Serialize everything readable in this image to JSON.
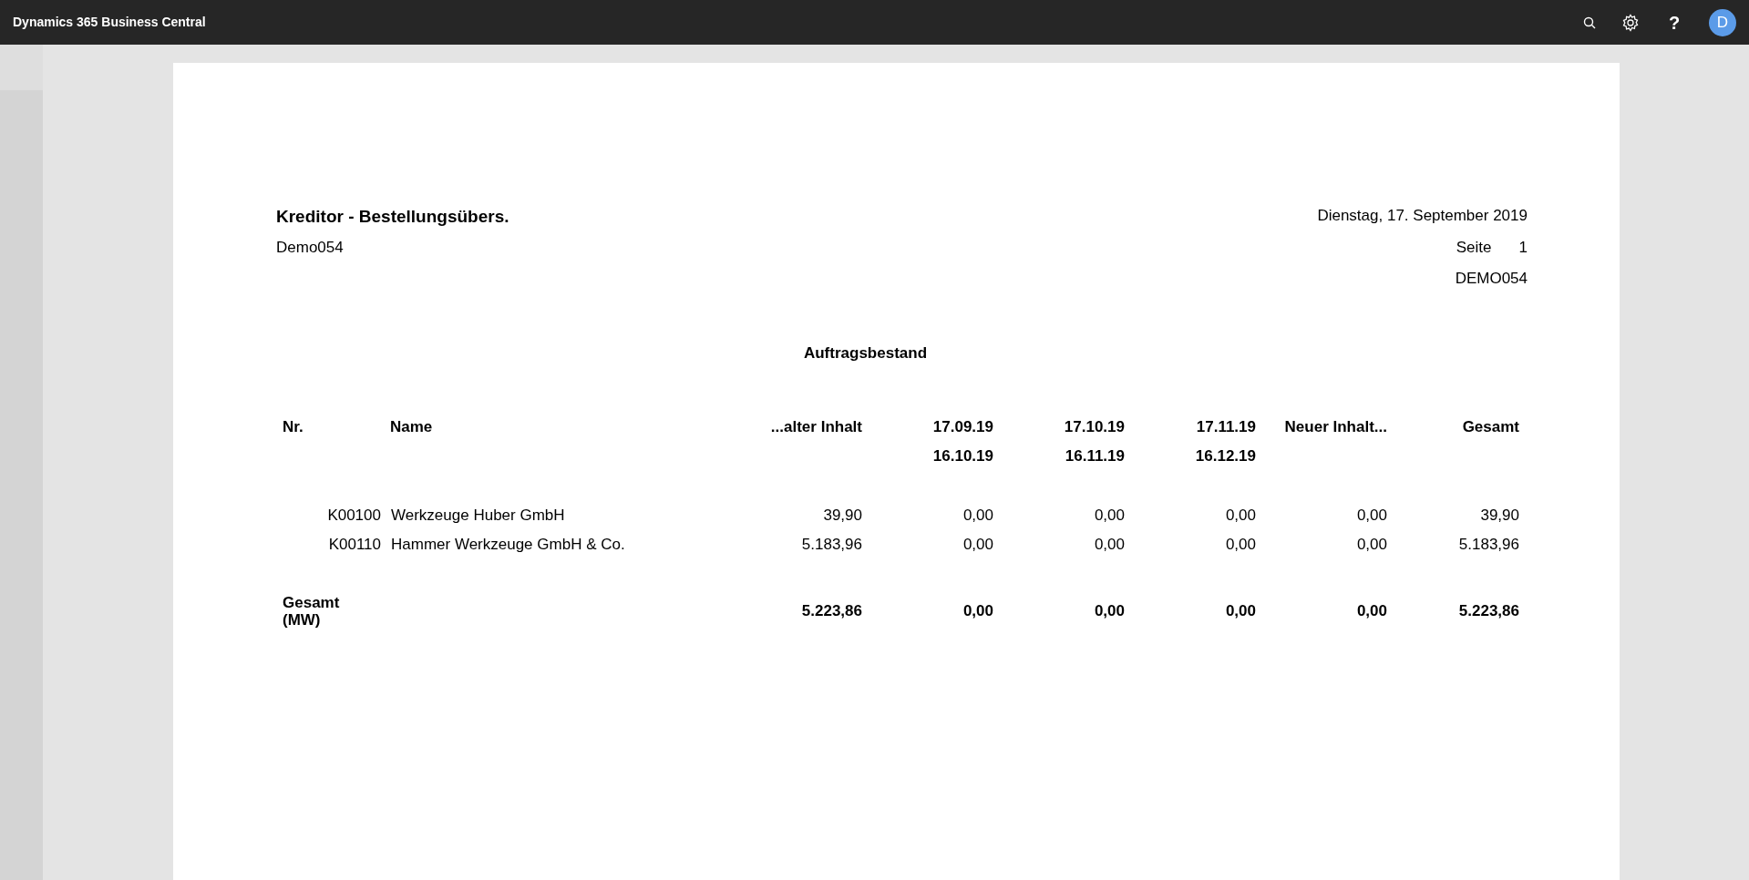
{
  "top_bar": {
    "app_title": "Dynamics 365 Business Central",
    "help_label": "?",
    "avatar_initial": "D"
  },
  "report": {
    "title": "Kreditor - Bestellungsübers.",
    "company": "Demo054",
    "date": "Dienstag, 17. September 2019",
    "page_label": "Seite",
    "page_number": "1",
    "user": "DEMO054",
    "section_title": "Auftragsbestand",
    "columns": [
      {
        "lines": [
          "Nr."
        ]
      },
      {
        "lines": [
          "Name"
        ]
      },
      {
        "lines": [
          "...alter Inhalt"
        ]
      },
      {
        "lines": [
          "17.09.19",
          "16.10.19"
        ]
      },
      {
        "lines": [
          "17.10.19",
          "16.11.19"
        ]
      },
      {
        "lines": [
          "17.11.19",
          "16.12.19"
        ]
      },
      {
        "lines": [
          "Neuer Inhalt..."
        ]
      },
      {
        "lines": [
          "Gesamt"
        ]
      }
    ],
    "rows": [
      {
        "nr": "K00100",
        "name": "Werkzeuge Huber GmbH",
        "values": [
          "39,90",
          "0,00",
          "0,00",
          "0,00",
          "0,00",
          "39,90"
        ]
      },
      {
        "nr": "K00110",
        "name": "Hammer Werkzeuge GmbH & Co.",
        "values": [
          "5.183,96",
          "0,00",
          "0,00",
          "0,00",
          "0,00",
          "5.183,96"
        ]
      }
    ],
    "total": {
      "label_lines": [
        "Gesamt",
        "(MW)"
      ],
      "values": [
        "5.223,86",
        "0,00",
        "0,00",
        "0,00",
        "0,00",
        "5.223,86"
      ]
    }
  }
}
